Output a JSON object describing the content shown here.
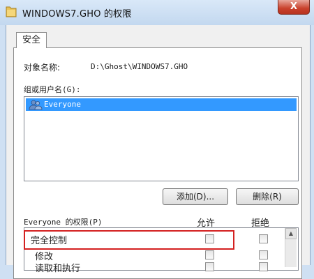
{
  "window": {
    "title": "WINDOWS7.GHO 的权限",
    "close_label": "X"
  },
  "tabs": [
    {
      "label": "安全",
      "active": true
    }
  ],
  "object": {
    "label": "对象名称:",
    "value": "D:\\Ghost\\WINDOWS7.GHO"
  },
  "groups": {
    "label": "组或用户名(G):",
    "items": [
      {
        "name": "Everyone",
        "icon": "users-icon",
        "selected": true
      }
    ]
  },
  "buttons": {
    "add": "添加(D)...",
    "remove": "删除(R)"
  },
  "permissions": {
    "header_label": "Everyone 的权限(P)",
    "col_allow": "允许",
    "col_deny": "拒绝",
    "rows": [
      {
        "name": "完全控制",
        "allow": false,
        "deny": false
      },
      {
        "name": "修改",
        "allow": false,
        "deny": false
      },
      {
        "name": "读取和执行",
        "allow": false,
        "deny": false
      }
    ]
  },
  "colors": {
    "selection": "#3399ff",
    "highlight_border": "#d42020",
    "close_button": "#c9412c"
  }
}
